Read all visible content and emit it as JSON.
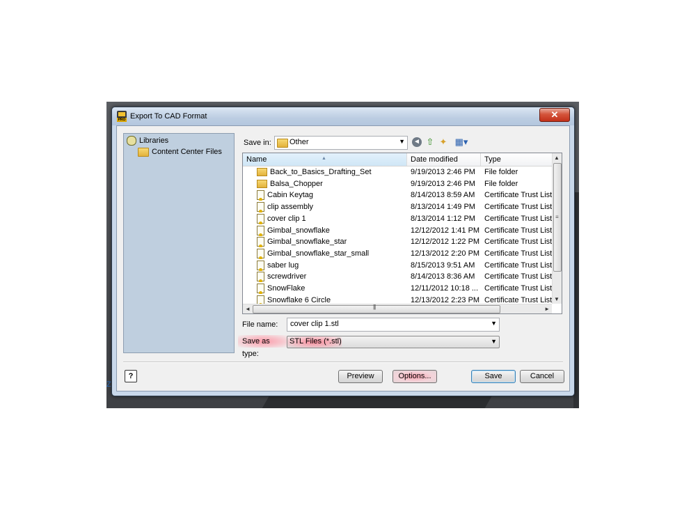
{
  "window": {
    "title": "Export To CAD Format",
    "app_icon": "pro-app-icon",
    "close_label": "✕"
  },
  "places": [
    {
      "label": "Libraries",
      "icon": "library-icon"
    },
    {
      "label": "Content Center Files",
      "icon": "folder-icon"
    }
  ],
  "save_in": {
    "label": "Save in:",
    "value": "Other"
  },
  "toolbar": {
    "back": "◄",
    "up": "⇧",
    "new_folder": "✦",
    "view": "▦▾"
  },
  "columns": {
    "name": "Name",
    "date": "Date modified",
    "type": "Type"
  },
  "files": [
    {
      "name": "Back_to_Basics_Drafting_Set",
      "date": "9/19/2013 2:46 PM",
      "type": "File folder",
      "icon": "folder"
    },
    {
      "name": "Balsa_Chopper",
      "date": "9/19/2013 2:46 PM",
      "type": "File folder",
      "icon": "folder"
    },
    {
      "name": "Cabin Keytag",
      "date": "8/14/2013 8:59 AM",
      "type": "Certificate Trust List",
      "icon": "cert"
    },
    {
      "name": "clip assembly",
      "date": "8/13/2014 1:49 PM",
      "type": "Certificate Trust List",
      "icon": "cert"
    },
    {
      "name": "cover clip 1",
      "date": "8/13/2014 1:12 PM",
      "type": "Certificate Trust List",
      "icon": "cert"
    },
    {
      "name": "Gimbal_snowflake",
      "date": "12/12/2012 1:41 PM",
      "type": "Certificate Trust List",
      "icon": "cert"
    },
    {
      "name": "Gimbal_snowflake_star",
      "date": "12/12/2012 1:22 PM",
      "type": "Certificate Trust List",
      "icon": "cert"
    },
    {
      "name": "Gimbal_snowflake_star_small",
      "date": "12/13/2012 2:20 PM",
      "type": "Certificate Trust List",
      "icon": "cert"
    },
    {
      "name": "saber lug",
      "date": "8/15/2013 9:51 AM",
      "type": "Certificate Trust List",
      "icon": "cert"
    },
    {
      "name": "screwdriver",
      "date": "8/14/2013 8:36 AM",
      "type": "Certificate Trust List",
      "icon": "cert"
    },
    {
      "name": "SnowFlake",
      "date": "12/11/2012 10:18 ...",
      "type": "Certificate Trust List",
      "icon": "cert"
    },
    {
      "name": "Snowflake 6 Circle",
      "date": "12/13/2012 2:23 PM",
      "type": "Certificate Trust List",
      "icon": "cert"
    }
  ],
  "file_name": {
    "label": "File name:",
    "value": "cover clip 1.stl"
  },
  "save_type": {
    "label": "Save as type:",
    "value": "STL Files (*.stl)"
  },
  "buttons": {
    "help": "?",
    "preview": "Preview",
    "options": "Options...",
    "save": "Save",
    "cancel": "Cancel"
  },
  "background": {
    "fragment": "Z"
  },
  "colors": {
    "places_bg": "#bfcfdf",
    "highlight": "#ff8c9c",
    "title_bar": "#c9d8ea"
  }
}
